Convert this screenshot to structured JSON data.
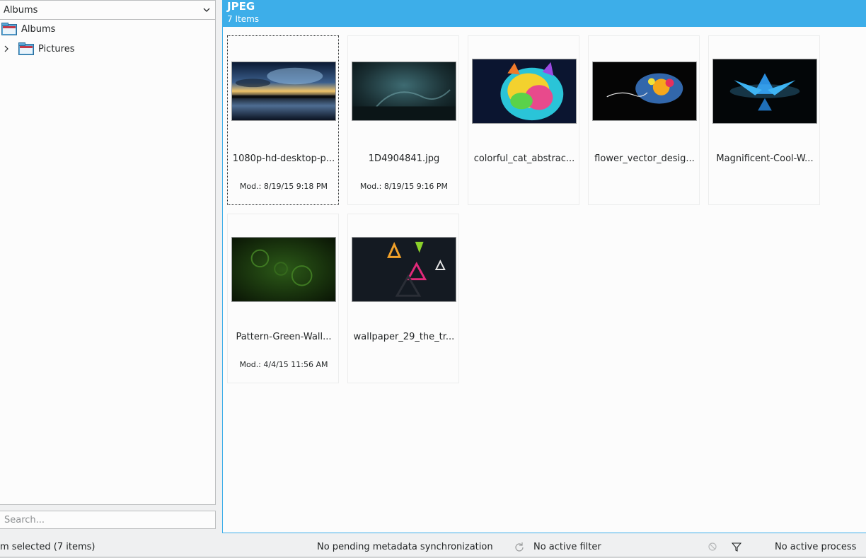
{
  "left_panel": {
    "combo_value": "Albums",
    "tree": [
      {
        "label": "Albums"
      },
      {
        "label": "Pictures"
      }
    ],
    "search_placeholder": "Search..."
  },
  "main": {
    "title": "JPEG",
    "count": "7 Items",
    "items": [
      {
        "name": "1080p-hd-desktop-p...",
        "mod": "Mod.: 8/19/15 9:18 PM"
      },
      {
        "name": "1D4904841.jpg",
        "mod": "Mod.: 8/19/15 9:16 PM"
      },
      {
        "name": "colorful_cat_abstrac...",
        "mod": ""
      },
      {
        "name": "flower_vector_desig...",
        "mod": ""
      },
      {
        "name": "Magnificent-Cool-W...",
        "mod": ""
      },
      {
        "name": "Pattern-Green-Wall...",
        "mod": "Mod.: 4/4/15 11:56 AM"
      },
      {
        "name": "wallpaper_29_the_tr...",
        "mod": ""
      }
    ]
  },
  "status_bar": {
    "selection": "m selected (7 items)",
    "sync": "No pending metadata synchronization",
    "filter": "No active filter",
    "process": "No active process"
  },
  "colors": {
    "accent": "#3daee9",
    "background": "#eff0f1",
    "view_background": "#fcfcfc"
  }
}
